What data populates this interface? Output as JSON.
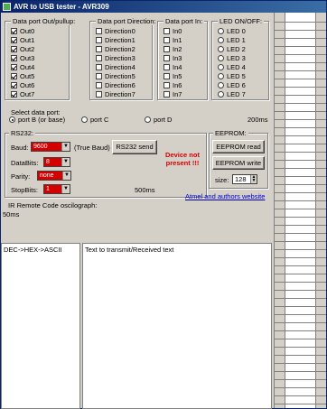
{
  "window": {
    "title": "AVR to USB tester - AVR309"
  },
  "groups": {
    "data_out": {
      "title": "Data port Out/pullup:",
      "items": [
        {
          "label": "Out0",
          "checked": true
        },
        {
          "label": "Out1",
          "checked": true
        },
        {
          "label": "Out2",
          "checked": true
        },
        {
          "label": "Out3",
          "checked": true
        },
        {
          "label": "Out4",
          "checked": true
        },
        {
          "label": "Out5",
          "checked": true
        },
        {
          "label": "Out6",
          "checked": true
        },
        {
          "label": "Out7",
          "checked": true
        }
      ]
    },
    "data_dir": {
      "title": "Data port Direction:",
      "items": [
        {
          "label": "Direction0",
          "checked": false
        },
        {
          "label": "Direction1",
          "checked": false
        },
        {
          "label": "Direction2",
          "checked": false
        },
        {
          "label": "Direction3",
          "checked": false
        },
        {
          "label": "Direction4",
          "checked": false
        },
        {
          "label": "Direction5",
          "checked": false
        },
        {
          "label": "Direction6",
          "checked": false
        },
        {
          "label": "Direction7",
          "checked": false
        }
      ]
    },
    "data_in": {
      "title": "Data port In:",
      "items": [
        {
          "label": "In0",
          "checked": false
        },
        {
          "label": "In1",
          "checked": false
        },
        {
          "label": "In2",
          "checked": false
        },
        {
          "label": "In3",
          "checked": false
        },
        {
          "label": "In4",
          "checked": false
        },
        {
          "label": "In5",
          "checked": false
        },
        {
          "label": "In6",
          "checked": false
        },
        {
          "label": "In7",
          "checked": false
        }
      ]
    },
    "led": {
      "title": "LED ON/OFF:",
      "items": [
        {
          "label": "LED 0"
        },
        {
          "label": "LED 1"
        },
        {
          "label": "LED 2"
        },
        {
          "label": "LED 3"
        },
        {
          "label": "LED 4"
        },
        {
          "label": "LED 5"
        },
        {
          "label": "LED 6"
        },
        {
          "label": "LED 7"
        }
      ]
    },
    "select_port": {
      "title": "Select data port:",
      "options": [
        {
          "label": "port B (or base)",
          "selected": true
        },
        {
          "label": "port C",
          "selected": false
        },
        {
          "label": "port D",
          "selected": false
        }
      ],
      "interval": "200ms"
    },
    "rs232": {
      "title": "RS232:",
      "baud_label": "Baud:",
      "baud_value": "9600",
      "true_baud": "(True Baud)",
      "send_button": "RS232 send",
      "databits_label": "DataBits:",
      "databits_value": "8",
      "parity_label": "Parity:",
      "parity_value": "none",
      "stopbits_label": "StopBits:",
      "stopbits_value": "1",
      "interval": "500ms"
    },
    "eeprom": {
      "title": "EEPROM:",
      "read_button": "EEPROM read",
      "write_button": "EEPROM write",
      "size_label": "size:",
      "size_value": "128"
    }
  },
  "status": {
    "device_message": "Device not present !!!"
  },
  "link": {
    "text": "Atmel and authors website"
  },
  "ir": {
    "title": "IR Remote Code oscilograph:",
    "interval": "50ms"
  },
  "panels": {
    "left_label": "DEC->HEX->ASCII",
    "right_label": "Text to transmit/Received text"
  }
}
